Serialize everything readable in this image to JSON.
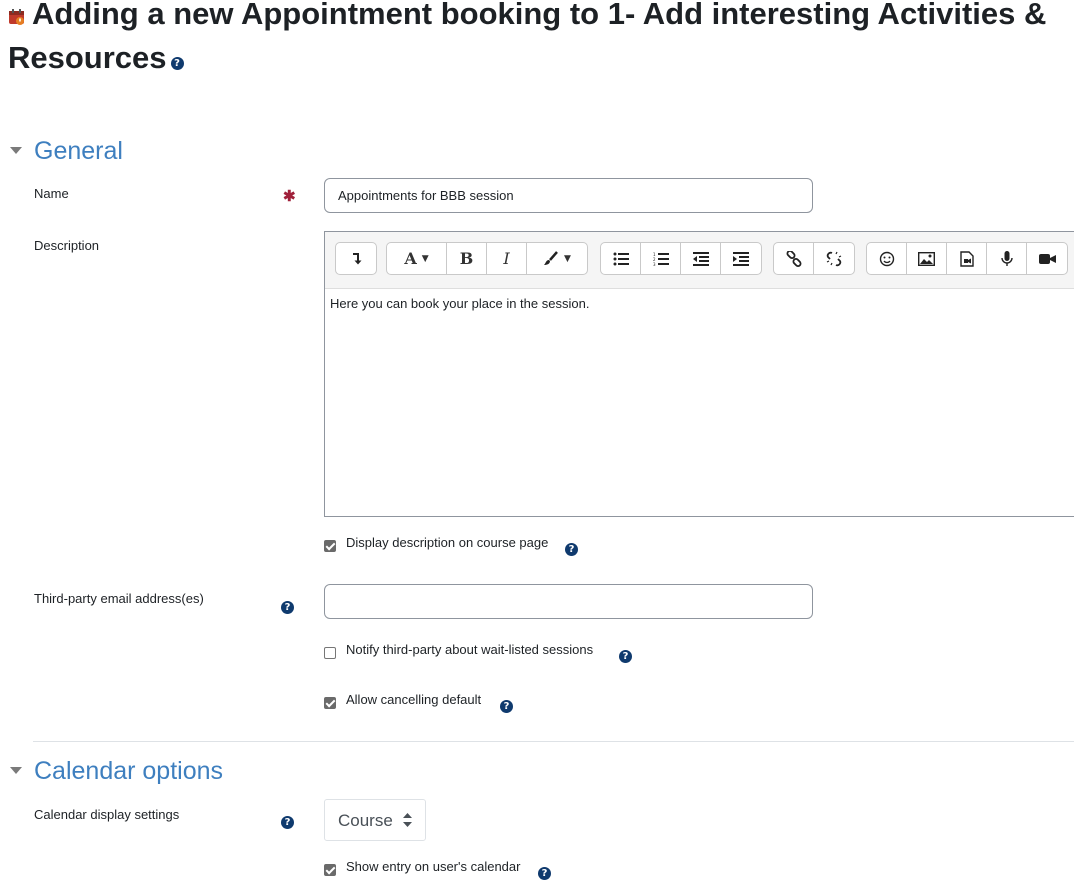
{
  "page": {
    "title": "Adding a new Appointment booking to 1- Add interesting Activities & Resources",
    "activity_icon": "calendar-icon",
    "help_icon": "question-circle-icon"
  },
  "sections": {
    "general": {
      "title": "General"
    },
    "calendar": {
      "title": "Calendar options"
    }
  },
  "fields": {
    "name": {
      "label": "Name",
      "value": "Appointments for BBB session"
    },
    "description": {
      "label": "Description",
      "content": "Here you can book your place in the session."
    },
    "display_description": {
      "label": "Display description on course page",
      "checked": true
    },
    "third_party_email": {
      "label": "Third-party email address(es)",
      "value": ""
    },
    "notify_third_party": {
      "label": "Notify third-party about wait-listed sessions",
      "checked": false
    },
    "allow_cancelling": {
      "label": "Allow cancelling default",
      "checked": true
    },
    "calendar_display": {
      "label": "Calendar display settings",
      "value": "Course"
    },
    "show_entry": {
      "label": "Show entry on user's calendar",
      "checked": true
    }
  },
  "toolbar": {
    "groups": [
      [
        "show-more-icon"
      ],
      [
        "font-style-icon",
        "bold-icon",
        "italic-icon",
        "text-color-icon"
      ],
      [
        "unordered-list-icon",
        "ordered-list-icon",
        "outdent-icon",
        "indent-icon"
      ],
      [
        "link-icon",
        "unlink-icon"
      ],
      [
        "emoji-icon",
        "image-icon",
        "media-icon",
        "record-audio-icon",
        "record-video-icon"
      ]
    ]
  },
  "colors": {
    "section_title": "#3e7fbf",
    "required": "#a0203a",
    "help_icon": "#0f3a6e",
    "checkbox_checked": "#6a6a6a"
  }
}
